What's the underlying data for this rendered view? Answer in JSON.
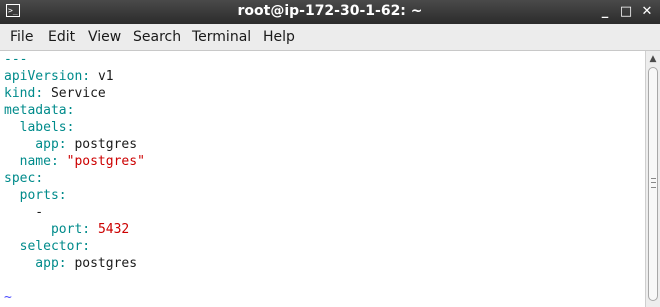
{
  "window": {
    "title": "root@ip-172-30-1-62: ~",
    "terminal_icon_glyph": ">_",
    "controls": {
      "minimize": "_",
      "maximize": "□",
      "close": "✕"
    }
  },
  "menu": {
    "items": [
      "File",
      "Edit",
      "View",
      "Search",
      "Terminal",
      "Help"
    ]
  },
  "editor": {
    "lines": [
      {
        "parts": [
          {
            "text": "---",
            "cls": "k"
          }
        ]
      },
      {
        "parts": [
          {
            "text": "apiVersion",
            "cls": "k"
          },
          {
            "text": ": ",
            "cls": "k"
          },
          {
            "text": "v1",
            "cls": "t"
          }
        ]
      },
      {
        "parts": [
          {
            "text": "kind",
            "cls": "k"
          },
          {
            "text": ": ",
            "cls": "k"
          },
          {
            "text": "Service",
            "cls": "t"
          }
        ]
      },
      {
        "parts": [
          {
            "text": "metadata",
            "cls": "k"
          },
          {
            "text": ":",
            "cls": "k"
          }
        ]
      },
      {
        "parts": [
          {
            "text": "  labels",
            "cls": "k"
          },
          {
            "text": ":",
            "cls": "k"
          }
        ]
      },
      {
        "parts": [
          {
            "text": "    app",
            "cls": "k"
          },
          {
            "text": ": ",
            "cls": "k"
          },
          {
            "text": "postgres",
            "cls": "t"
          }
        ]
      },
      {
        "parts": [
          {
            "text": "  name",
            "cls": "k"
          },
          {
            "text": ": ",
            "cls": "k"
          },
          {
            "text": "\"postgres\"",
            "cls": "s"
          }
        ]
      },
      {
        "parts": [
          {
            "text": "spec",
            "cls": "k"
          },
          {
            "text": ":",
            "cls": "k"
          }
        ]
      },
      {
        "parts": [
          {
            "text": "  ports",
            "cls": "k"
          },
          {
            "text": ":",
            "cls": "k"
          }
        ]
      },
      {
        "parts": [
          {
            "text": "    -",
            "cls": "t"
          }
        ]
      },
      {
        "parts": [
          {
            "text": "      port",
            "cls": "k"
          },
          {
            "text": ": ",
            "cls": "k"
          },
          {
            "text": "5432",
            "cls": "n"
          }
        ]
      },
      {
        "parts": [
          {
            "text": "  selector",
            "cls": "k"
          },
          {
            "text": ":",
            "cls": "k"
          }
        ]
      },
      {
        "parts": [
          {
            "text": "    app",
            "cls": "k"
          },
          {
            "text": ": ",
            "cls": "k"
          },
          {
            "text": "postgres",
            "cls": "t"
          }
        ]
      },
      {
        "parts": [
          {
            "text": "",
            "cls": "t"
          }
        ]
      },
      {
        "parts": [
          {
            "text": "~",
            "cls": "c"
          }
        ]
      }
    ]
  },
  "colors": {
    "key": "#008b8b",
    "string": "#cc0000",
    "number": "#cc0000",
    "text": "#1a1a1a",
    "tilde": "#4a4aff",
    "titlebar": "#2b2b2b"
  }
}
